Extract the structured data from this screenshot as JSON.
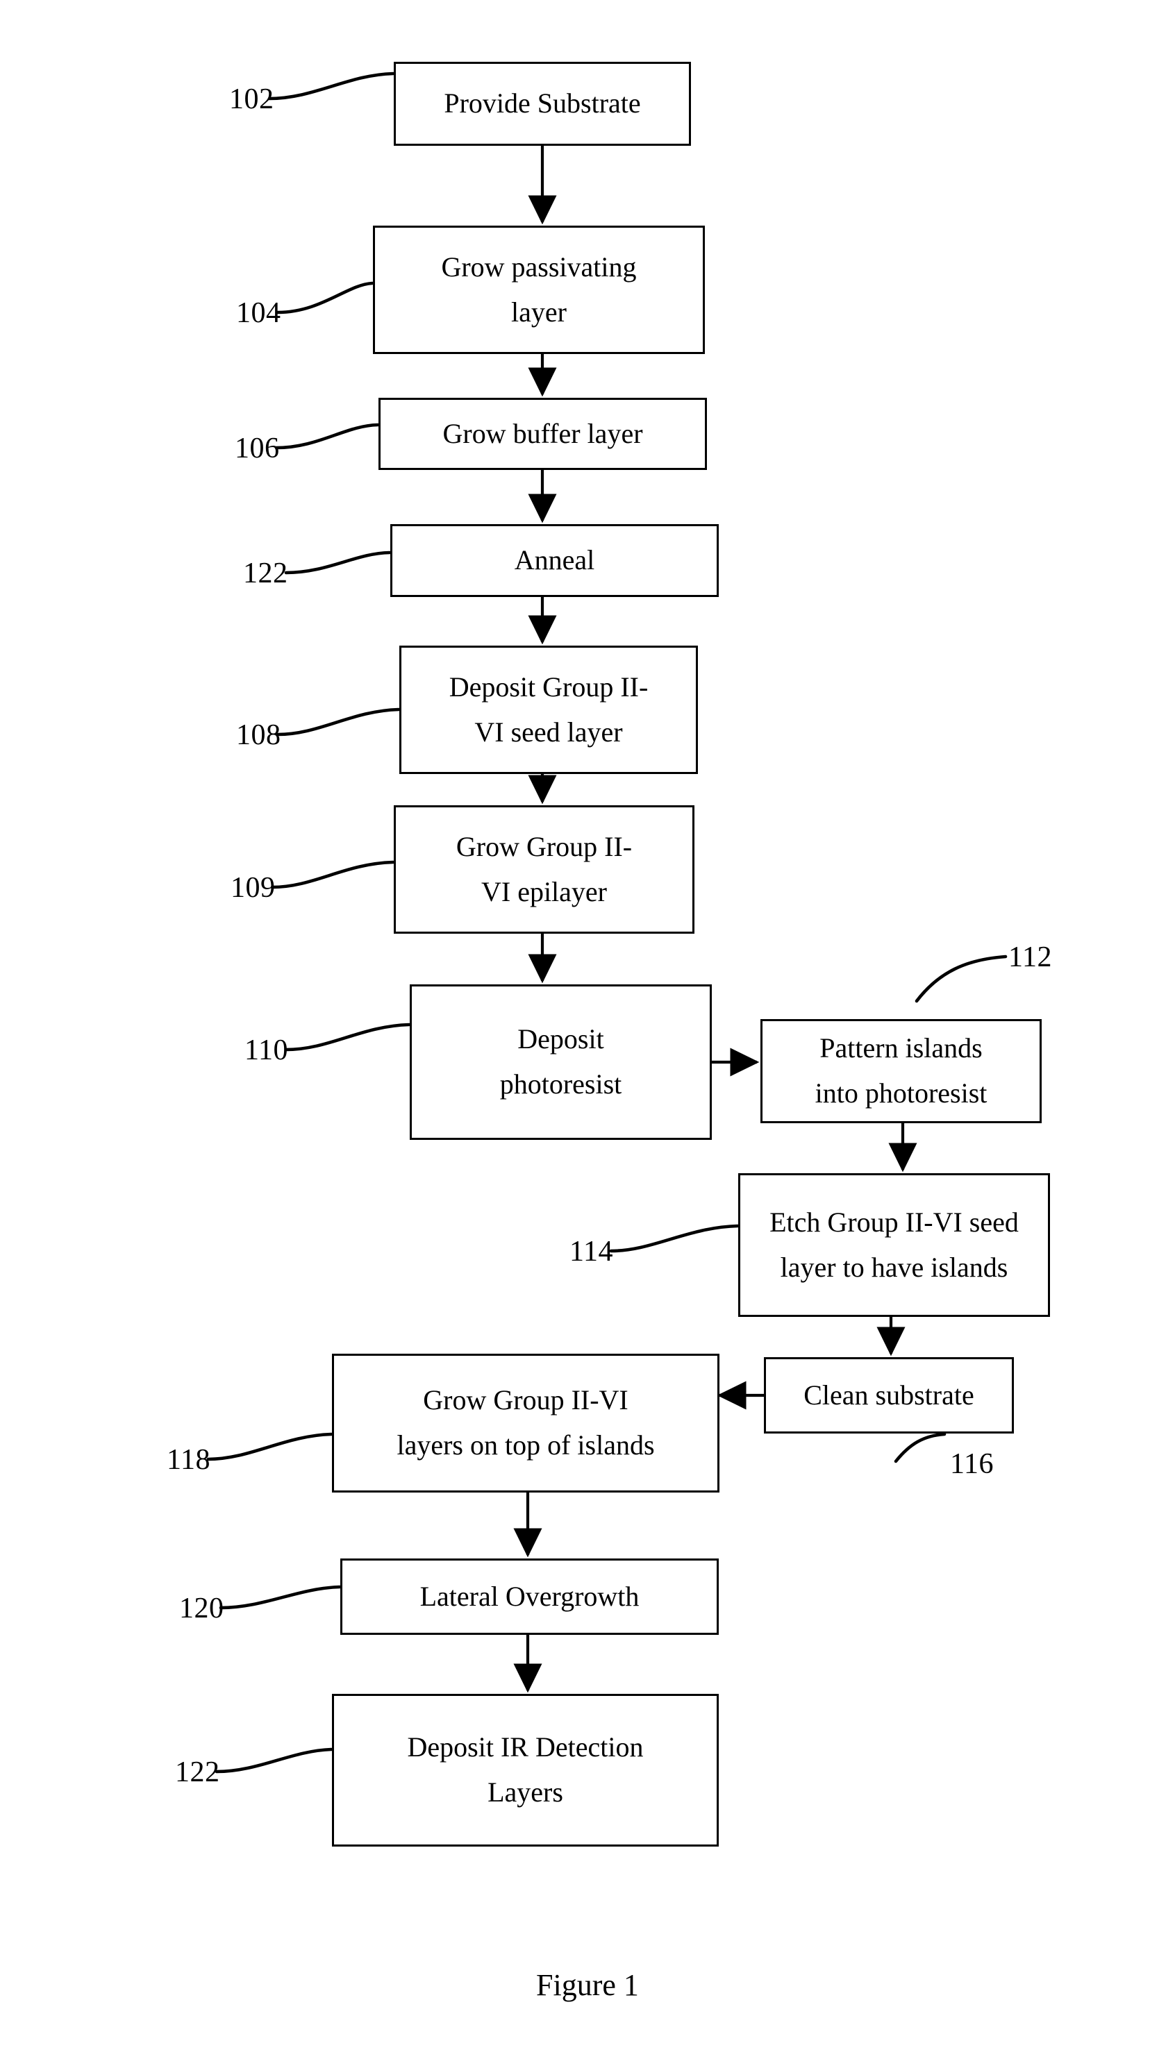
{
  "figure": {
    "caption": "Figure 1"
  },
  "colors": {
    "ink": "#000000",
    "paper": "#ffffff"
  },
  "flowchart": {
    "type": "process-flow-diagram",
    "orientation": "top-to-bottom with right-hand branch",
    "nodes": [
      {
        "ref": "102",
        "label": "Provide Substrate"
      },
      {
        "ref": "104",
        "label": "Grow passivating\nlayer"
      },
      {
        "ref": "106",
        "label": "Grow buffer layer"
      },
      {
        "ref": "122",
        "label": "Anneal"
      },
      {
        "ref": "108",
        "label": "Deposit Group II-\nVI seed layer"
      },
      {
        "ref": "109",
        "label": "Grow Group II-\nVI epilayer"
      },
      {
        "ref": "110",
        "label": "Deposit\nphotoresist"
      },
      {
        "ref": "112",
        "label": "Pattern islands\ninto photoresist"
      },
      {
        "ref": "114",
        "label": "Etch Group II-VI seed\nlayer to have islands"
      },
      {
        "ref": "116",
        "label": "Clean substrate"
      },
      {
        "ref": "118",
        "label": "Grow Group II-VI\nlayers on top of islands"
      },
      {
        "ref": "120",
        "label": "Lateral Overgrowth"
      },
      {
        "ref": "122b",
        "label": "Deposit IR Detection\nLayers"
      }
    ],
    "edges": [
      {
        "from": "102",
        "to": "104",
        "direction": "down"
      },
      {
        "from": "104",
        "to": "106",
        "direction": "down"
      },
      {
        "from": "106",
        "to": "122",
        "direction": "down"
      },
      {
        "from": "122",
        "to": "108",
        "direction": "down"
      },
      {
        "from": "108",
        "to": "109",
        "direction": "down"
      },
      {
        "from": "109",
        "to": "110",
        "direction": "down"
      },
      {
        "from": "110",
        "to": "112",
        "direction": "right"
      },
      {
        "from": "112",
        "to": "114",
        "direction": "down"
      },
      {
        "from": "114",
        "to": "116",
        "direction": "down"
      },
      {
        "from": "116",
        "to": "118",
        "direction": "left"
      },
      {
        "from": "118",
        "to": "120",
        "direction": "down"
      },
      {
        "from": "120",
        "to": "122b",
        "direction": "down"
      }
    ],
    "numerals": {
      "n102": "102",
      "n104": "104",
      "n106": "106",
      "n122a": "122",
      "n108": "108",
      "n109": "109",
      "n110": "110",
      "n112": "112",
      "n114": "114",
      "n116": "116",
      "n118": "118",
      "n120": "120",
      "n122b": "122"
    }
  }
}
